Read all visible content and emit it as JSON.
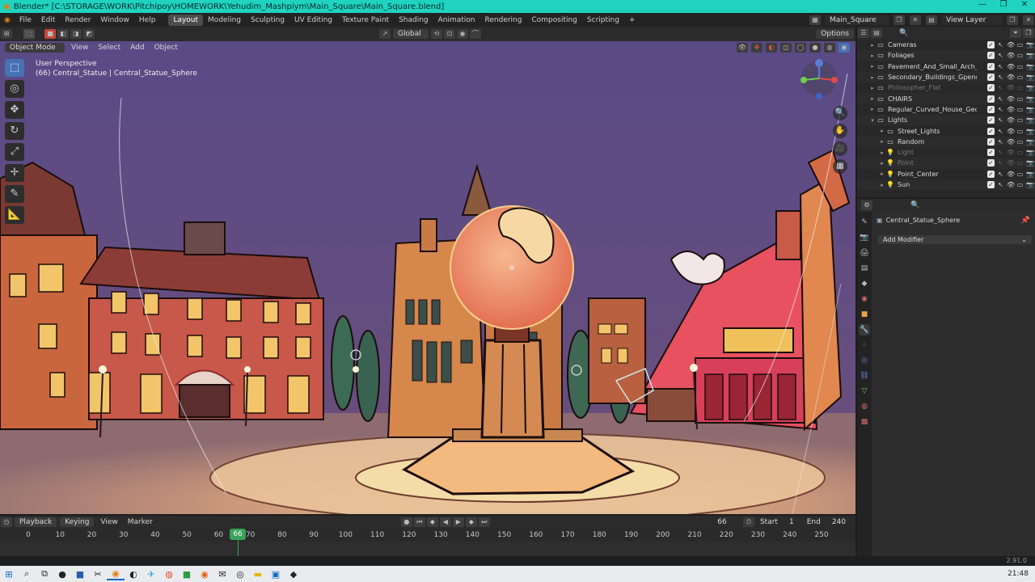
{
  "window": {
    "title": "Blender* [C:\\STORAGE\\WORK\\Pitchipoy\\HOMEWORK\\Yehudim_Mashpiym\\Main_Square\\Main_Square.blend]",
    "controls": [
      "—",
      "❐",
      "✕"
    ]
  },
  "menubar": {
    "menus": [
      "File",
      "Edit",
      "Render",
      "Window",
      "Help"
    ],
    "workspaces": [
      "Layout",
      "Modeling",
      "Sculpting",
      "UV Editing",
      "Texture Paint",
      "Shading",
      "Animation",
      "Rendering",
      "Compositing",
      "Scripting"
    ],
    "active_workspace": "Layout",
    "add_workspace": "+",
    "scene": "Main_Square",
    "view_layer": "View Layer"
  },
  "toolheader": {
    "transform_orientation": "Global",
    "options": "Options"
  },
  "viewport": {
    "mode": "Object Mode",
    "menus": [
      "View",
      "Select",
      "Add",
      "Object"
    ],
    "perspective_label": "User Perspective",
    "active_object_label": "(66) Central_Statue | Central_Statue_Sphere",
    "gizmo_axes": {
      "x": "X",
      "y": "Y",
      "z": "Z"
    }
  },
  "left_tools": [
    {
      "name": "select-box",
      "glyph": "⬚",
      "active": true
    },
    {
      "name": "cursor",
      "glyph": "◎",
      "active": false
    },
    {
      "name": "move",
      "glyph": "✥",
      "active": false
    },
    {
      "name": "rotate",
      "glyph": "↻",
      "active": false
    },
    {
      "name": "scale",
      "glyph": "⤢",
      "active": false
    },
    {
      "name": "transform",
      "glyph": "✛",
      "active": false
    },
    {
      "name": "annotate",
      "glyph": "✎",
      "active": false
    },
    {
      "name": "measure",
      "glyph": "📐",
      "active": false
    }
  ],
  "timeline": {
    "menus": [
      "Playback",
      "Keying",
      "View",
      "Marker"
    ],
    "current_frame": "66",
    "start_label": "Start",
    "start": "1",
    "end_label": "End",
    "end": "240",
    "ticks": [
      0,
      10,
      20,
      30,
      40,
      50,
      60,
      70,
      80,
      90,
      100,
      110,
      120,
      130,
      140,
      150,
      160,
      170,
      180,
      190,
      200,
      210,
      220,
      230,
      240,
      250
    ],
    "playhead_frame": 66
  },
  "outliner": {
    "rows": [
      {
        "label": "Cameras",
        "type": "collection",
        "dim": false,
        "expanded": false,
        "indent": 0
      },
      {
        "label": "Foliages",
        "type": "collection",
        "dim": false,
        "expanded": false,
        "indent": 0
      },
      {
        "label": "Pavement_And_Small_Arch_Sha",
        "type": "collection",
        "dim": false,
        "expanded": false,
        "indent": 0
      },
      {
        "label": "Secondary_Buildings_Gpencil",
        "type": "collection",
        "dim": false,
        "expanded": false,
        "indent": 0
      },
      {
        "label": "Philosopher_Flat",
        "type": "collection",
        "dim": true,
        "expanded": false,
        "indent": 0
      },
      {
        "label": "CHAIRS",
        "type": "collection",
        "dim": false,
        "expanded": false,
        "indent": 0
      },
      {
        "label": "Regular_Curved_House_Geomet",
        "type": "collection",
        "dim": false,
        "expanded": false,
        "indent": 0
      },
      {
        "label": "Lights",
        "type": "collection",
        "dim": false,
        "expanded": true,
        "indent": 0
      },
      {
        "label": "Street_Lights",
        "type": "collection",
        "dim": false,
        "expanded": false,
        "indent": 1
      },
      {
        "label": "Random",
        "type": "collection",
        "dim": false,
        "expanded": false,
        "indent": 1
      },
      {
        "label": "Light",
        "type": "light",
        "dim": true,
        "expanded": false,
        "indent": 1
      },
      {
        "label": "Point",
        "type": "light",
        "dim": true,
        "expanded": false,
        "indent": 1
      },
      {
        "label": "Point_Center",
        "type": "light",
        "dim": false,
        "expanded": false,
        "indent": 1
      },
      {
        "label": "Sun",
        "type": "light",
        "dim": false,
        "expanded": false,
        "indent": 1
      }
    ]
  },
  "properties": {
    "object_name": "Central_Statue_Sphere",
    "add_modifier": "Add Modifier"
  },
  "status": {
    "version": "2.91.0"
  },
  "taskbar": {
    "time": "21:48"
  }
}
